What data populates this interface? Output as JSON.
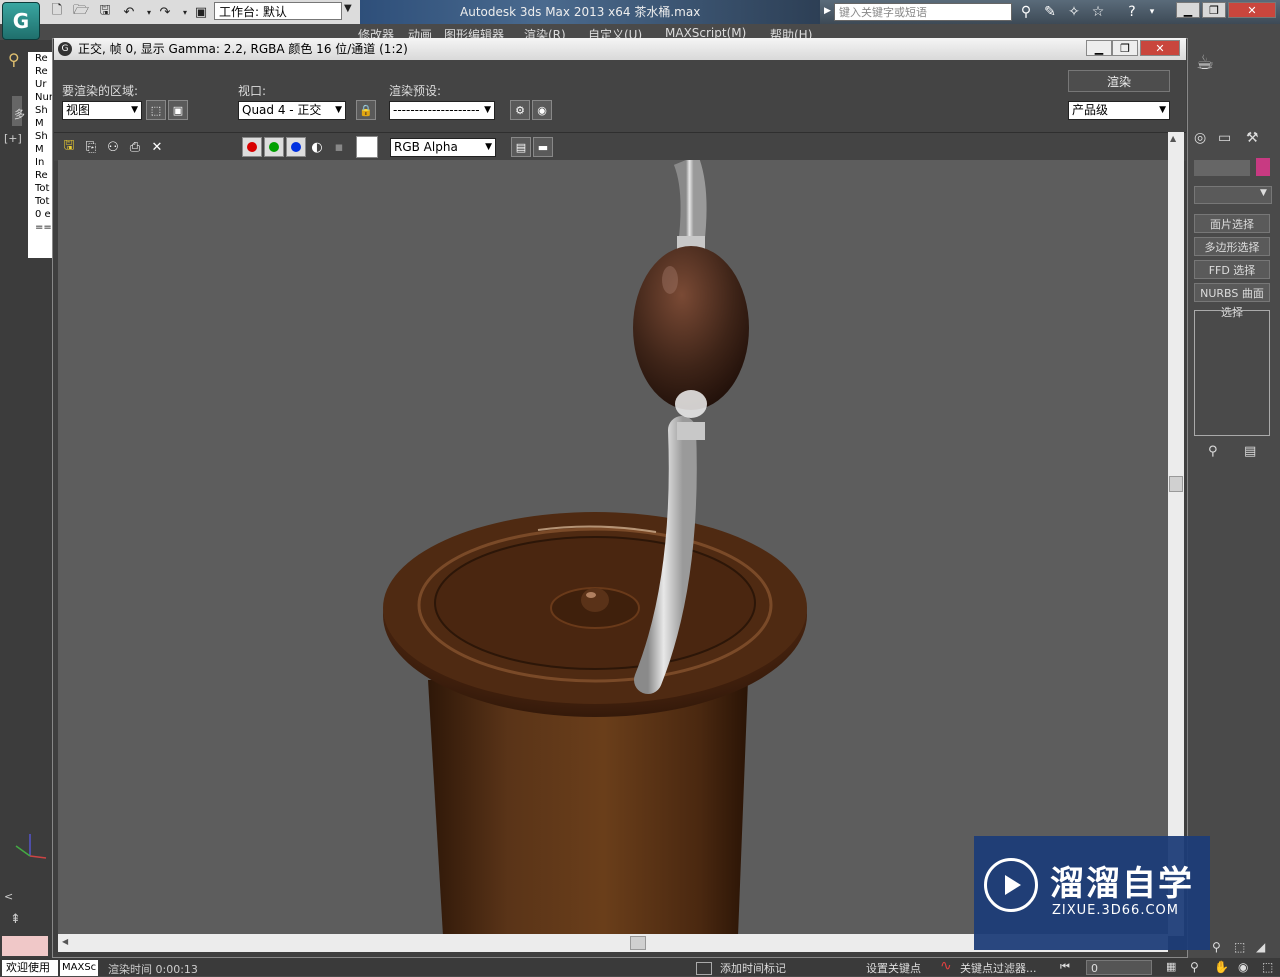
{
  "app": {
    "title": "Autodesk 3ds Max  2013 x64      茶水桶.max",
    "workspace_label": "工作台: 默认",
    "search_placeholder": "键入关键字或短语"
  },
  "background_ui": {
    "menu_partial": [
      "修改器",
      "动画",
      "图形编辑器",
      "渲染(R)",
      "自定义(U)",
      "MAXScript(M)",
      "帮助(H)"
    ],
    "listener_lines": [
      "Re",
      "Re",
      "Ur",
      "Nur",
      "Sh",
      "M",
      "Sh",
      "M",
      "In",
      "Re",
      "Tot",
      "Tot",
      "0 e",
      "==="
    ],
    "viewport_label": "[+]",
    "side_tab_label": "多",
    "right_panel_buttons": [
      "面片选择",
      "多边形选择",
      "FFD 选择",
      "NURBS 曲面选择"
    ],
    "status": {
      "welcome": "欢迎使用",
      "maxs": "MAXSc",
      "render_time": "渲染时间  0:00:13",
      "add_time_tag": "添加时间标记",
      "set_key": "设置关键点",
      "key_filter": "关键点过滤器...",
      "frame_value": "0"
    }
  },
  "render_window": {
    "title": "正交, 帧 0, 显示 Gamma: 2.2, RGBA 颜色 16 位/通道 (1:2)",
    "area_label": "要渲染的区域:",
    "area_value": "视图",
    "viewport_label": "视口:",
    "viewport_value": "Quad 4 - 正交",
    "preset_label": "渲染预设:",
    "preset_value": "--------------------",
    "render_button": "渲染",
    "quality_value": "产品级",
    "channel_value": "RGB Alpha",
    "colors": {
      "red": "#d80000",
      "green": "#00a000",
      "blue": "#0030e0",
      "background": "#5d5d5d",
      "cup_brown": "#5a3418"
    }
  },
  "watermark": {
    "brand": "溜溜自学",
    "url": "ZIXUE.3D66.COM"
  }
}
